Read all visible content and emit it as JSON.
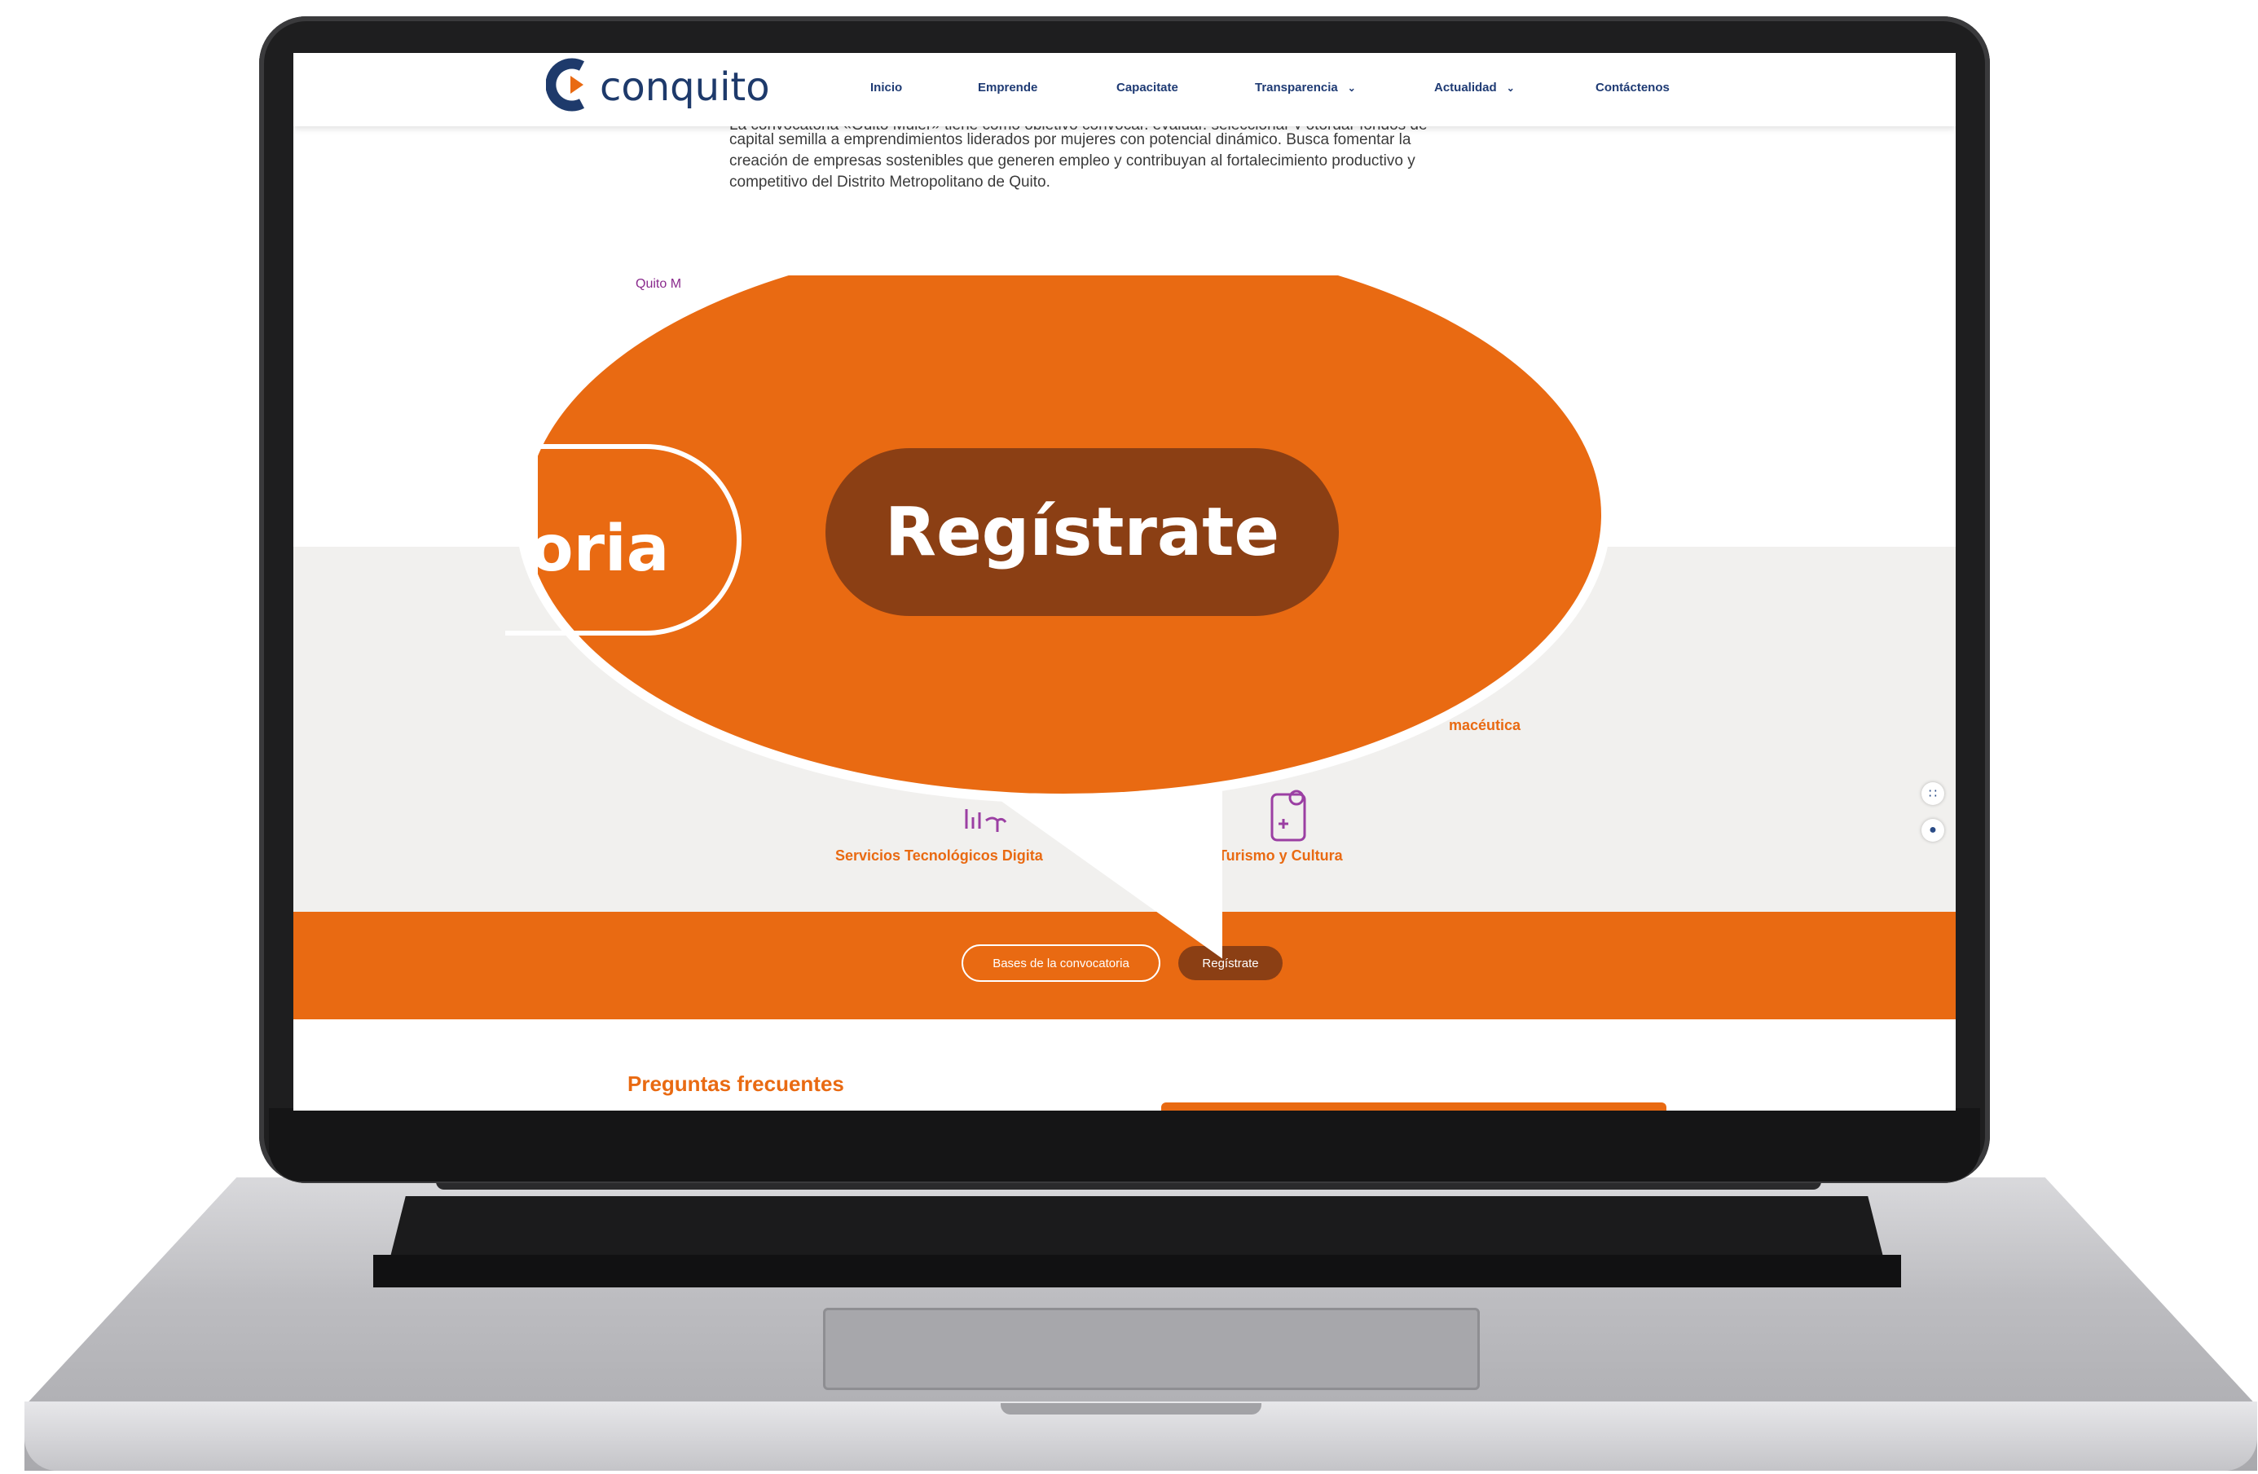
{
  "site": {
    "logo_text": "conquito",
    "nav": [
      "Inicio",
      "Emprende",
      "Capacitate",
      "Transparencia",
      "Actualidad",
      "Contáctenos"
    ],
    "nav_dropdown_icon": "chevron-down-icon"
  },
  "intro": {
    "line1": "La convocatoria «Quito Mujer» tiene como objetivo convocar, evaluar, seleccionar y otorgar fondos de",
    "line2": "capital semilla a emprendimientos liderados por mujeres con potencial dinámico. Busca fomentar la",
    "line3": "creación de empresas sostenibles que generen empleo y contribuyan al fortalecimiento productivo y",
    "line4": "competitivo del Distrito Metropolitano de Quito."
  },
  "quito_label": "Quito M",
  "categories": {
    "partial": "macéutica",
    "tech": "Servicios Tecnológicos Digita",
    "tourism": "Turismo y Cultura"
  },
  "cta": {
    "bases": "Bases de la convocatoria",
    "register": "Regístrate"
  },
  "faq_title": "Preguntas frecuentes",
  "zoom": {
    "outline_text": "oria",
    "register_text": "Regístrate"
  },
  "colors": {
    "orange": "#e96a12",
    "brown": "#8b3f14",
    "navy": "#1f3b74",
    "gray_band": "#f1f0ee"
  }
}
